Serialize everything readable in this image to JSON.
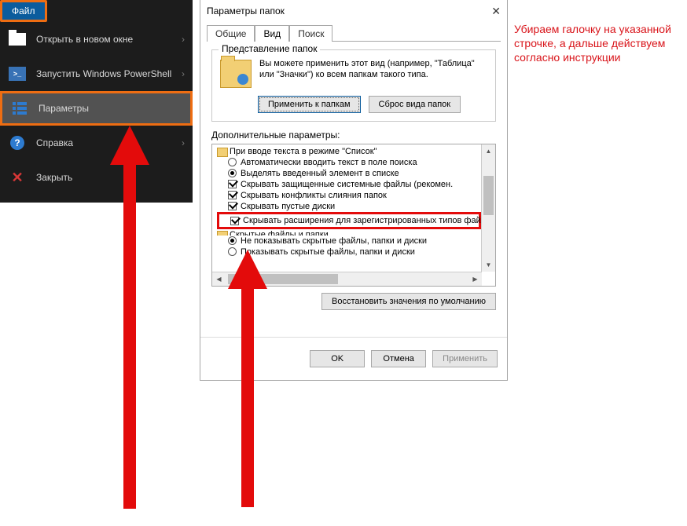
{
  "menu": {
    "file_label": "Файл",
    "items": [
      {
        "label": "Открыть в новом окне",
        "chev": true
      },
      {
        "label": "Запустить Windows PowerShell",
        "chev": true
      },
      {
        "label": "Параметры",
        "chev": false
      },
      {
        "label": "Справка",
        "chev": true
      },
      {
        "label": "Закрыть",
        "chev": false
      }
    ]
  },
  "dialog": {
    "title": "Параметры папок",
    "close_glyph": "✕",
    "tabs": {
      "general": "Общие",
      "view": "Вид",
      "search": "Поиск"
    },
    "group_legend": "Представление папок",
    "group_desc": "Вы можете применить этот вид (например, \"Таблица\" или \"Значки\") ко всем папкам такого типа.",
    "apply_folders_btn": "Применить к папкам",
    "reset_folders_btn": "Сброс вида папок",
    "extra_params_label": "Дополнительные параметры:",
    "tree": {
      "header": "При вводе текста в режиме \"Список\"",
      "r1": "Автоматически вводить текст в поле поиска",
      "r2": "Выделять введенный элемент в списке",
      "c1": "Скрывать защищенные системные файлы (рекомен.",
      "c2": "Скрывать конфликты слияния папок",
      "c3": "Скрывать пустые диски",
      "highlight": "Скрывать расширения для зарегистрированных типов файлов",
      "cut": "Скрытые файлы и папки",
      "r3": "Не показывать скрытые файлы, папки и диски",
      "r4": "Показывать скрытые файлы, папки и диски"
    },
    "restore_btn": "Восстановить значения по умолчанию",
    "ok_btn": "OK",
    "cancel_btn": "Отмена",
    "apply_btn": "Применить"
  },
  "annotation": "Убираем галочку на указанной строчке, а дальше действуем согласно инструкции",
  "glyphs": {
    "chev_right": "›",
    "arr_up": "▲",
    "arr_down": "▼",
    "arr_left": "◀",
    "arr_right": "▶"
  }
}
